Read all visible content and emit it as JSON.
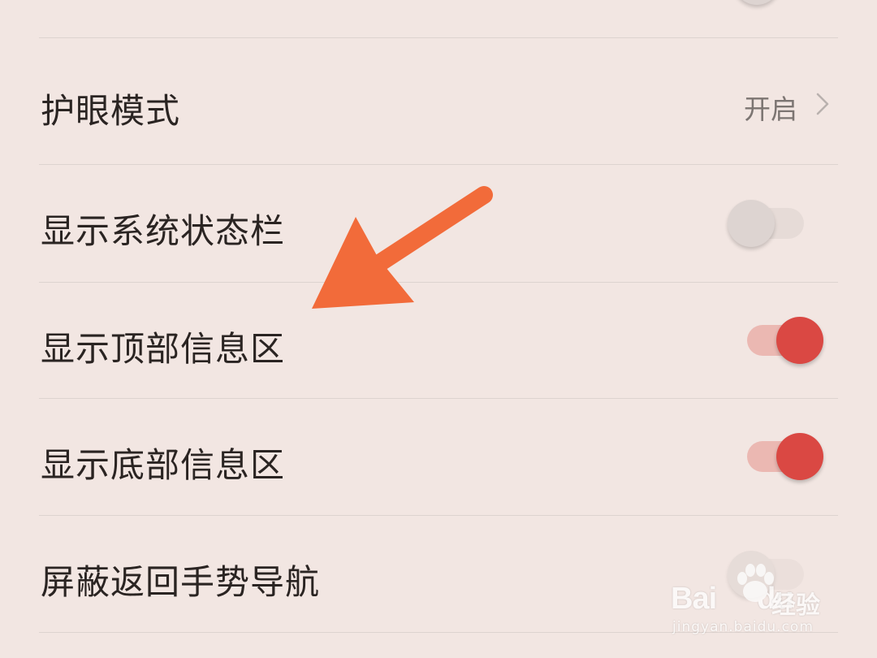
{
  "settings": {
    "eye_protection": {
      "label": "护眼模式",
      "value": "开启"
    },
    "show_status_bar": {
      "label": "显示系统状态栏",
      "enabled": false
    },
    "show_top_info": {
      "label": "显示顶部信息区",
      "enabled": true
    },
    "show_bottom_info": {
      "label": "显示底部信息区",
      "enabled": true
    },
    "block_back_gesture": {
      "label": "屏蔽返回手势导航",
      "enabled": false
    }
  },
  "colors": {
    "background": "#F2E6E2",
    "toggle_on": "#DA4843",
    "toggle_on_track": "#EBB8B2",
    "annotation_arrow": "#F26B3A"
  },
  "watermark": {
    "brand": "Bai",
    "brand_suffix": "du",
    "product": "经验",
    "url": "jingyan.baidu.com"
  }
}
